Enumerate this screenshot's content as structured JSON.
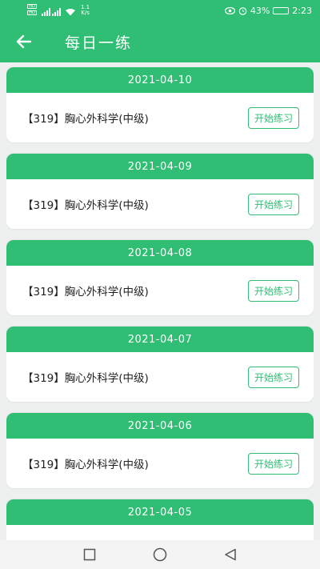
{
  "status_bar": {
    "network_speed_value": "1.1",
    "network_speed_unit": "K/s",
    "battery": "43%",
    "time": "2:23"
  },
  "header": {
    "title": "每日一练"
  },
  "cards": [
    {
      "date": "2021-04-10",
      "subject": "【319】胸心外科学(中级)",
      "button_label": "开始练习"
    },
    {
      "date": "2021-04-09",
      "subject": "【319】胸心外科学(中级)",
      "button_label": "开始练习"
    },
    {
      "date": "2021-04-08",
      "subject": "【319】胸心外科学(中级)",
      "button_label": "开始练习"
    },
    {
      "date": "2021-04-07",
      "subject": "【319】胸心外科学(中级)",
      "button_label": "开始练习"
    },
    {
      "date": "2021-04-06",
      "subject": "【319】胸心外科学(中级)",
      "button_label": "开始练习"
    },
    {
      "date": "2021-04-05",
      "subject": "",
      "button_label": ""
    }
  ],
  "icons": {
    "back": "arrow-left-icon",
    "nav_recent": "square-icon",
    "nav_home": "circle-icon",
    "nav_back": "triangle-icon"
  },
  "colors": {
    "accent": "#2fbe73",
    "background": "#eef0ef"
  }
}
